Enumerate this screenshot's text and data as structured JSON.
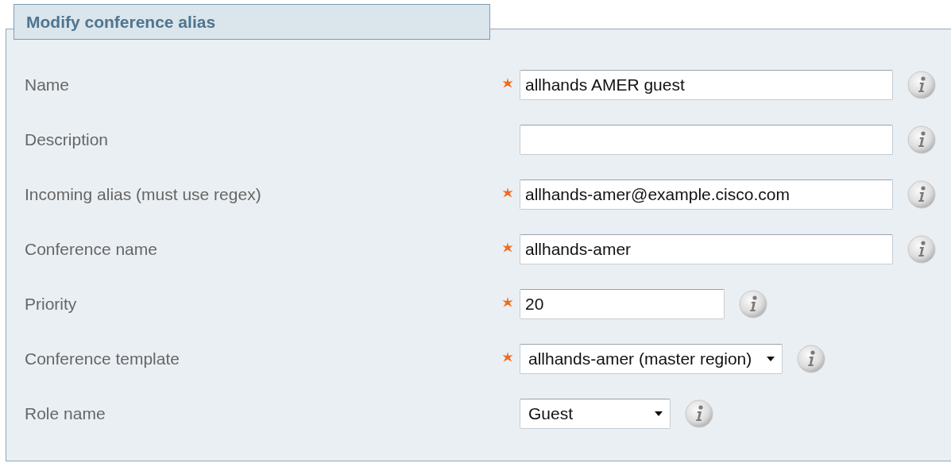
{
  "panel": {
    "title": "Modify conference alias"
  },
  "fields": [
    {
      "label": "Name",
      "kind": "text",
      "required": true,
      "value": "allhands AMER guest"
    },
    {
      "label": "Description",
      "kind": "text",
      "required": false
    },
    {
      "label": "Incoming alias (must use regex)",
      "kind": "text",
      "required": true,
      "value": "allhands-amer@example.cisco.com"
    },
    {
      "label": "Conference name",
      "kind": "text",
      "required": true,
      "value": "allhands-amer"
    },
    {
      "label": "Priority",
      "kind": "number",
      "required": true,
      "value": "20"
    },
    {
      "label": "Conference template",
      "kind": "select",
      "required": true,
      "value": "allhands-amer (master region)"
    },
    {
      "label": "Role name",
      "kind": "select",
      "required": false,
      "value": "Guest"
    }
  ]
}
